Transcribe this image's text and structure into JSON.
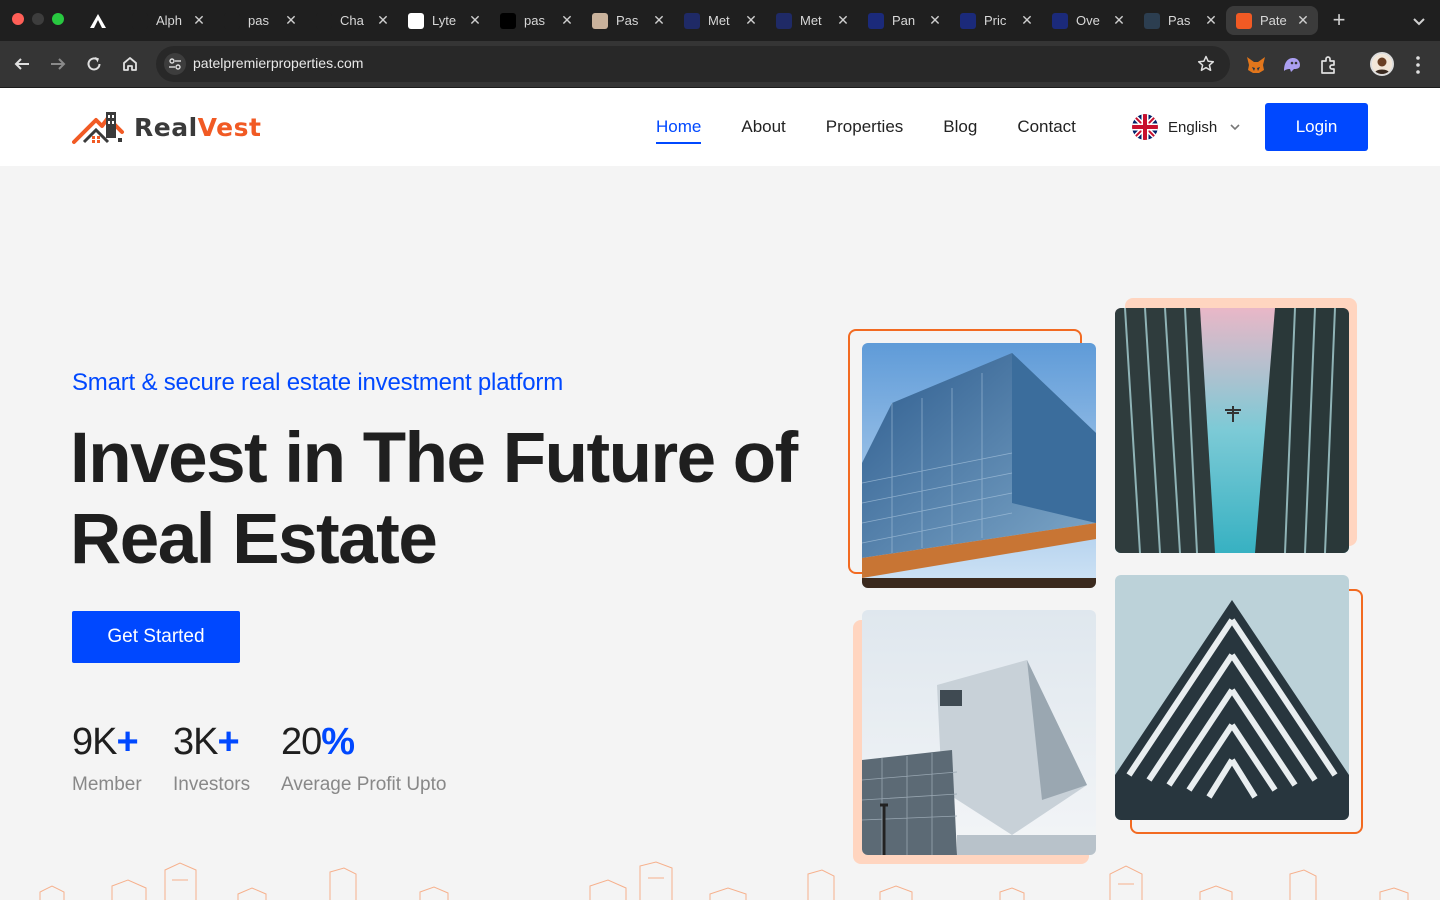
{
  "browser": {
    "tabs": [
      {
        "title": "Alph",
        "icon": "alpha-icon",
        "color": "#1f1f1f"
      },
      {
        "title": "pas",
        "icon": "github-icon",
        "color": "#1f1f1f"
      },
      {
        "title": "Cha",
        "icon": "chatgpt-icon",
        "color": "#1f1f1f"
      },
      {
        "title": "Lyte",
        "icon": "lyte-icon",
        "color": "#ffffff"
      },
      {
        "title": "pas",
        "icon": "triangle-icon",
        "color": "#000000"
      },
      {
        "title": "Pas",
        "icon": "portrait-icon",
        "color": "#c9b29c"
      },
      {
        "title": "Met",
        "icon": "meta-icon",
        "color": "#1f2a66"
      },
      {
        "title": "Met",
        "icon": "meta-icon",
        "color": "#1f2a66"
      },
      {
        "title": "Pan",
        "icon": "shield-icon",
        "color": "#1b2a7a"
      },
      {
        "title": "Pric",
        "icon": "shield-icon",
        "color": "#1b2a7a"
      },
      {
        "title": "Ove",
        "icon": "shield-icon",
        "color": "#1b2a7a"
      },
      {
        "title": "Pas",
        "icon": "w-icon",
        "color": "#2c3e50"
      },
      {
        "title": "Pate",
        "icon": "realvest-icon",
        "color": "#f15a24",
        "active": true
      }
    ],
    "url": "patelpremierproperties.com"
  },
  "header": {
    "logo_real": "Real",
    "logo_vest": "Vest",
    "nav": [
      {
        "label": "Home",
        "active": true
      },
      {
        "label": "About"
      },
      {
        "label": "Properties"
      },
      {
        "label": "Blog"
      },
      {
        "label": "Contact"
      }
    ],
    "language": "English",
    "login_label": "Login"
  },
  "hero": {
    "eyebrow": "Smart & secure real estate investment platform",
    "headline_line1": "Invest in The Future of",
    "headline_line2": "Real Estate",
    "cta_label": "Get Started",
    "stats": [
      {
        "value": "9K",
        "suffix": "+",
        "label": "Member"
      },
      {
        "value": "3K",
        "suffix": "+",
        "label": "Investors"
      },
      {
        "value": "20",
        "suffix": "%",
        "label": "Average Profit Upto"
      }
    ]
  },
  "colors": {
    "brand_blue": "#0048ff",
    "brand_orange": "#f15a24",
    "accent_peach": "#ffd5c0",
    "page_bg": "#f4f4f4"
  }
}
